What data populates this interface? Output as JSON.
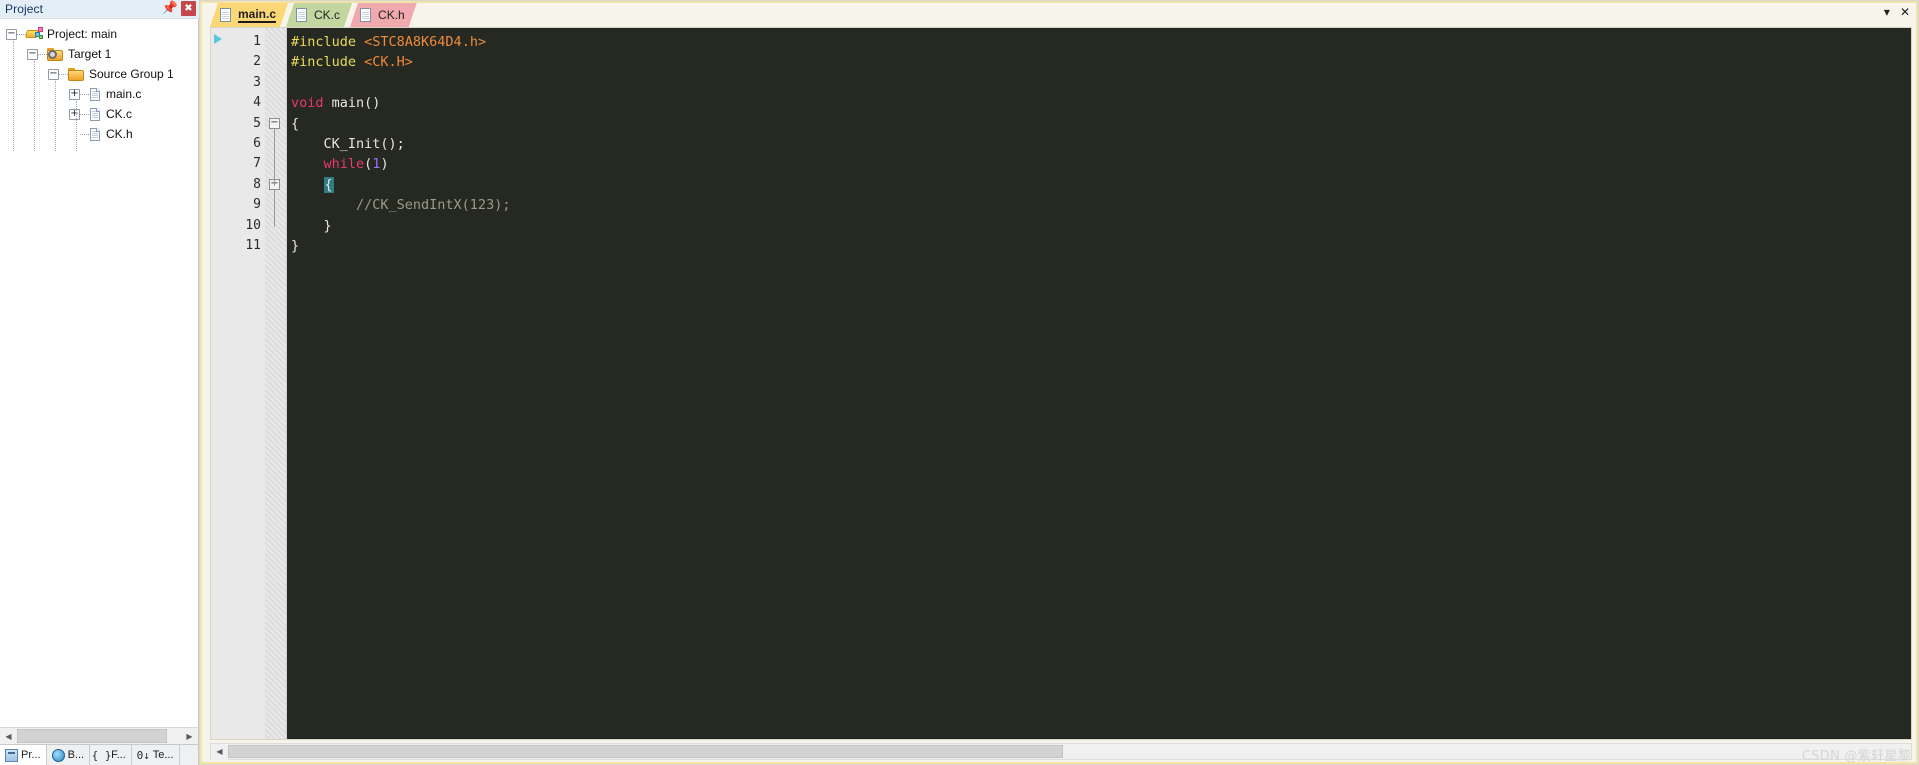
{
  "project_pane": {
    "title": "Project",
    "pin_icon": "pin-icon",
    "close_icon": "close-icon",
    "tree": [
      {
        "label": "Project: main",
        "depth": 0,
        "expander": "-",
        "icon": "project-icon"
      },
      {
        "label": "Target 1",
        "depth": 1,
        "expander": "-",
        "icon": "target-folder-icon"
      },
      {
        "label": "Source Group 1",
        "depth": 2,
        "expander": "-",
        "icon": "folder-icon"
      },
      {
        "label": "main.c",
        "depth": 3,
        "expander": "+",
        "icon": "c-file-icon"
      },
      {
        "label": "CK.c",
        "depth": 3,
        "expander": "+",
        "icon": "c-file-icon"
      },
      {
        "label": "CK.h",
        "depth": 3,
        "expander": "",
        "icon": "h-file-icon"
      }
    ],
    "hscroll": {
      "left_arrow": "◀",
      "right_arrow": "▶"
    },
    "view_tabs": [
      {
        "label": "Pr...",
        "icon": "project-view-icon",
        "active": true
      },
      {
        "label": "B...",
        "icon": "books-view-icon",
        "active": false
      },
      {
        "label": "F...",
        "icon": "functions-view-icon",
        "active": false
      },
      {
        "label": "Te...",
        "icon": "templates-view-icon",
        "active": false
      }
    ],
    "view_tab_glyphs": {
      "functions": "{ }",
      "templates": "0↓"
    }
  },
  "editor": {
    "tabs": [
      {
        "label": "main.c",
        "color": "#fbd775",
        "active": true
      },
      {
        "label": "CK.c",
        "color": "#c3d69f",
        "active": false
      },
      {
        "label": "CK.h",
        "color": "#f0a9ac",
        "active": false
      }
    ],
    "window_controls": {
      "minimize": "▾",
      "close": "✕"
    },
    "bookmark_icon": "bookmark-arrow-icon",
    "line_numbers": [
      "1",
      "2",
      "3",
      "4",
      "5",
      "6",
      "7",
      "8",
      "9",
      "10",
      "11"
    ],
    "fold_markers": [
      {
        "line": 5,
        "glyph": "−"
      },
      {
        "line": 8,
        "glyph": "−"
      }
    ],
    "code_lines": [
      {
        "n": 1,
        "tokens": [
          {
            "t": "#include ",
            "c": "pre"
          },
          {
            "t": "<STC8A8K64D4.h>",
            "c": "inc"
          }
        ]
      },
      {
        "n": 2,
        "tokens": [
          {
            "t": "#include ",
            "c": "pre"
          },
          {
            "t": "<CK.H>",
            "c": "inc"
          }
        ]
      },
      {
        "n": 3,
        "tokens": []
      },
      {
        "n": 4,
        "tokens": [
          {
            "t": "void",
            "c": "key"
          },
          {
            "t": " main()",
            "c": "txt"
          }
        ]
      },
      {
        "n": 5,
        "tokens": [
          {
            "t": "{",
            "c": "txt"
          }
        ]
      },
      {
        "n": 6,
        "tokens": [
          {
            "t": "    CK_Init();",
            "c": "txt"
          }
        ]
      },
      {
        "n": 7,
        "tokens": [
          {
            "t": "    ",
            "c": "txt"
          },
          {
            "t": "while",
            "c": "key"
          },
          {
            "t": "(",
            "c": "txt"
          },
          {
            "t": "1",
            "c": "num"
          },
          {
            "t": ")",
            "c": "txt"
          }
        ]
      },
      {
        "n": 8,
        "tokens": [
          {
            "t": "    ",
            "c": "txt"
          },
          {
            "t": "{",
            "c": "brace"
          }
        ]
      },
      {
        "n": 9,
        "tokens": [
          {
            "t": "        //CK_SendIntX(123);",
            "c": "cmt"
          }
        ]
      },
      {
        "n": 10,
        "tokens": [
          {
            "t": "    }",
            "c": "txt"
          }
        ]
      },
      {
        "n": 11,
        "tokens": [
          {
            "t": "}",
            "c": "txt"
          }
        ]
      }
    ],
    "hscroll": {
      "left_arrow": "◀",
      "right_arrow": "▶"
    }
  },
  "watermark": "CSDN @紫轩星黎",
  "colors": {
    "editor_background": "#262822",
    "gutter_background": "#e9e9e9",
    "preprocessor": "#e6db5a",
    "include_path": "#ef8b3a",
    "keyword": "#e8396a",
    "number": "#9a72ef",
    "comment": "#9b9b86",
    "plain_text": "#e8e6e0",
    "brace_highlight": "#2e7d84",
    "tab_active": "#fbd775",
    "close_button": "#c4474a"
  }
}
